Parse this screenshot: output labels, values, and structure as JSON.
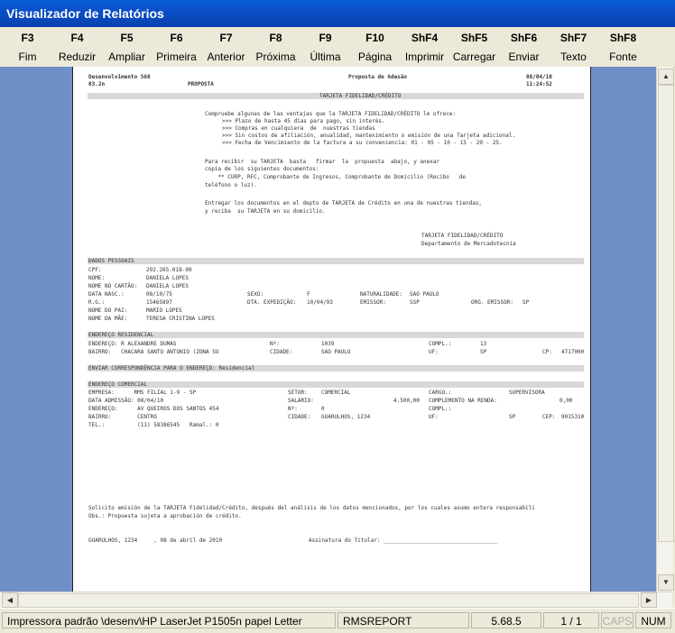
{
  "window": {
    "title": "Visualizador de Relatórios"
  },
  "toolbar": [
    {
      "key": "F3",
      "label": "Fim"
    },
    {
      "key": "F4",
      "label": "Reduzir"
    },
    {
      "key": "F5",
      "label": "Ampliar"
    },
    {
      "key": "F6",
      "label": "Primeira"
    },
    {
      "key": "F7",
      "label": "Anterior"
    },
    {
      "key": "F8",
      "label": "Próxima"
    },
    {
      "key": "F9",
      "label": "Última"
    },
    {
      "key": "F10",
      "label": "Página"
    },
    {
      "key": "ShF4",
      "label": "Imprimir"
    },
    {
      "key": "ShF5",
      "label": "Carregar"
    },
    {
      "key": "ShF6",
      "label": "Enviar"
    },
    {
      "key": "ShF7",
      "label": "Texto"
    },
    {
      "key": "ShF8",
      "label": "Fonte"
    }
  ],
  "report": {
    "header": {
      "company": "Desenvolvimento 568",
      "title": "Proposta de Adesão",
      "date": "08/04/10",
      "code": "03.2n",
      "subtitle": "PROPOSTA",
      "time": "11:24:52"
    },
    "section_card": "TARJETA FIDELIDAD/CRÉDITO",
    "intro": "Compruebe algunas de las ventajas que la TARJETA FIDELIDAD/CRÉDITO le ofrece:",
    "benefits": [
      ">>> Plazo de hasta 45 días para pago, sin interés.",
      ">>> Compras en cualquiera  de  nuestras tiendas",
      ">>> Sin costos de afiliación, anualidad, mantenimiento o emisión de una Tarjeta adicional.",
      ">>> Fecha de Vencimiento de la factura a su conveniencia: 01 - 05 - 10 - 15 - 20 - 25."
    ],
    "docs_lines": [
      "Para recibir  su TARJETA  basta   firmar  la  propuesta  abajo, y anexar",
      "copia de los siguientes documentos:",
      "    ** CURP, RFC, Comprobante de Ingresos, Comprobante de Domicilio (Recibo   de",
      "teléfono o luz)."
    ],
    "delivery_lines": [
      "Entregar los documentos en el depto de TARJETA de Crédito en una de nuestras tiendas,",
      "y reciba  su TARJETA en su domicilio."
    ],
    "sign_block": [
      "TARJETA FIDELIDAD/CRÉDITO",
      "Departamento de Mercadotecnia"
    ],
    "personal": {
      "header": "DADOS PESSOAIS",
      "cpf_label": "CPF:",
      "cpf": "292.265.018-90",
      "nome_label": "NOME:",
      "nome": "DANIELA LOPES",
      "cartao_label": "NOME NO CARTÃO:",
      "cartao": "DANIELA LOPES",
      "nasc_label": "DATA NASC.:",
      "nasc": "08/10/75",
      "sexo_label": "SEXO:",
      "sexo": "F",
      "natural_label": "NATURALIDADE:",
      "natural": "SAO PAULO",
      "rg_label": "R.G.:",
      "rg": "15465897",
      "expedicao_label": "DTA. EXPEDIÇÃO:",
      "expedicao": "10/04/93",
      "emissor_label": "EMISSOR:",
      "emissor": "SSP",
      "org_label": "ORG. EMISSOR:",
      "org": "SP",
      "pai_label": "NOME DO PAI:",
      "pai": "MARIO LOPES",
      "mae_label": "NOME DA MÃE:",
      "mae": "TERESA CRISTINA LOPES"
    },
    "residence": {
      "header": "ENDEREÇO RESIDENCIAL",
      "endereco": "ENDEREÇO: R ALEXANDRE DUMAS",
      "numero_label": "Nº:",
      "numero": "1039",
      "compl_label": "COMPL.:",
      "compl": "13",
      "bairro": "BAIRRO:   CHACARA SANTO ANTONIO (ZONA SU",
      "cidade_label": "CIDADE:",
      "cidade": "SAO PAULO",
      "uf_label": "UF:",
      "uf": "SP",
      "cep_label": "CP:",
      "cep": "4717000"
    },
    "correspondence": "ENVIAR CORRESPONDÊNCIA PARA O ENDEREÇO: Residencial",
    "commercial": {
      "header": "ENDEREÇO COMERCIAL",
      "empresa": "EMPRESA:      RMS FILIAL 1-9 - SP",
      "setor_label": "SETOR:",
      "setor": "COMERCIAL",
      "cargo_label": "CARGO.:",
      "cargo": "SUPERVISORA",
      "admissao": "DATA ADMISSÃO: 08/04/10",
      "salario_label": "SALÁRIO:",
      "salario": "4.500,00",
      "compl_renda_label": "COMPLEMENTO NA RENDA:",
      "compl_renda": "0,00",
      "endereco": "ENDEREÇO:      AV QUEIROS DOS SANTOS 454",
      "numero_label": "Nº:",
      "numero": "0",
      "compl_label": "COMPL.:",
      "bairro": "BAIRRO:        CENTRO",
      "cidade_label": "CIDADE:",
      "cidade": "GUARULHOS, 1234",
      "uf_label": "UF:",
      "uf": "SP",
      "cep_label": "CEP:",
      "cep": "9015310",
      "tel": "TEL.:          (11) 58386545   Ramal.: 0"
    },
    "footer_text": [
      "Solicito emisión de la TARJETA Fidelidad/Crédito, después del análisis de los datos mencionados, por los cuales asumo entera responsabili",
      "Obs.: Propuesta sujeta a aprobación de crédito."
    ],
    "place_date": "GUARULHOS, 1234     , 08 de abril de 2010",
    "signature_label": "Assinatura do Titular: ___________________________________"
  },
  "status": {
    "printer": "Impressora padrão \\desenv\\HP LaserJet P1505n papel Letter",
    "report": "RMSREPORT",
    "version": "5.68.5",
    "page": "1 / 1",
    "caps": "CAPS",
    "num": "NUM"
  }
}
